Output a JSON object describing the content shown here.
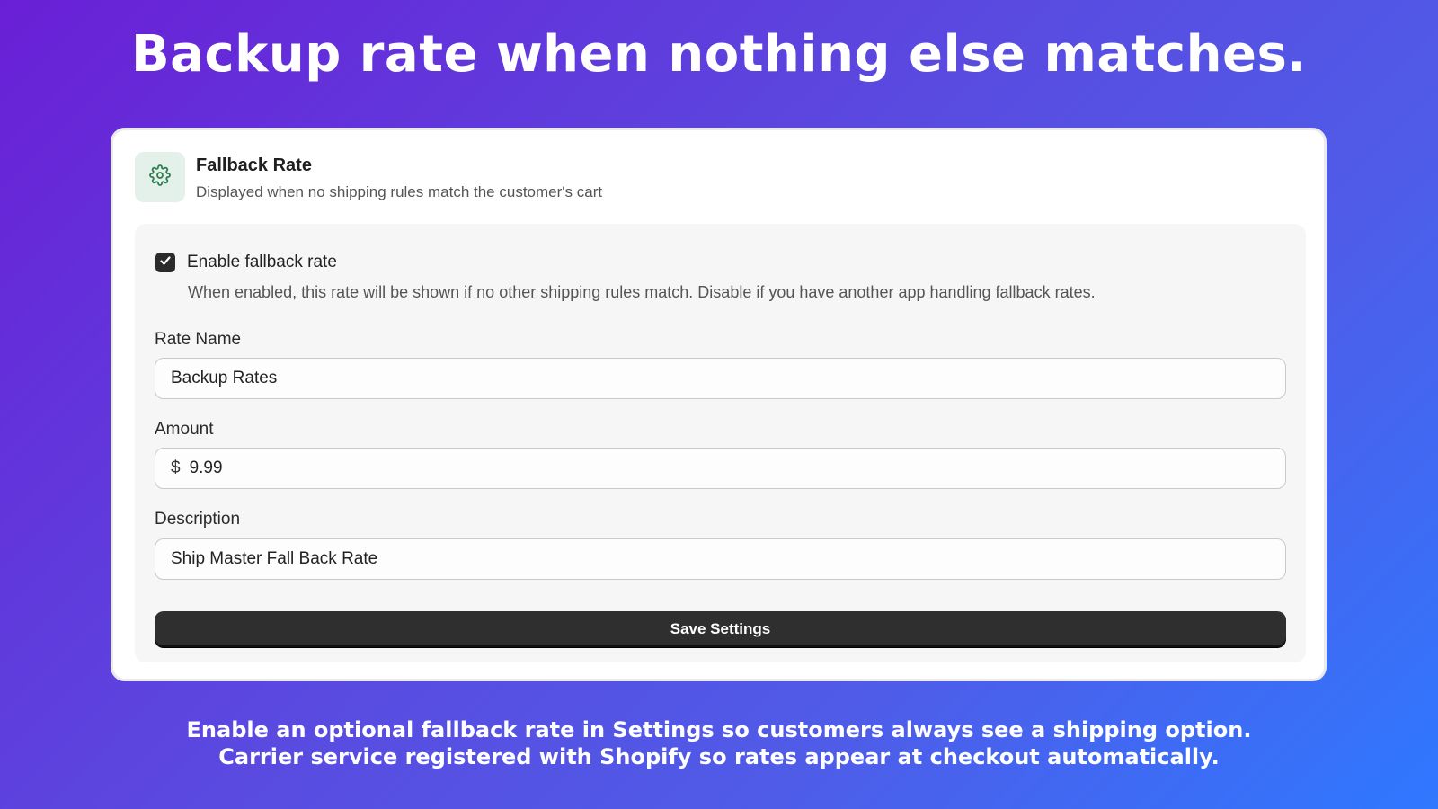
{
  "headline": "Backup rate when nothing else matches.",
  "card": {
    "icon": "gear-icon",
    "title": "Fallback Rate",
    "subtitle": "Displayed when no shipping rules match the customer's cart"
  },
  "settings": {
    "enable_checkbox": {
      "label": "Enable fallback rate",
      "checked": true
    },
    "enable_help": "When enabled, this rate will be shown if no other shipping rules match. Disable if you have another app handling fallback rates.",
    "rate_name": {
      "label": "Rate Name",
      "value": "Backup Rates"
    },
    "amount": {
      "label": "Amount",
      "prefix": "$",
      "value": "9.99"
    },
    "description": {
      "label": "Description",
      "value": "Ship Master Fall Back Rate"
    },
    "save_label": "Save Settings"
  },
  "footer": {
    "line1": "Enable an optional fallback rate in Settings so customers always see a shipping option.",
    "line2": "Carrier service registered with Shopify so rates appear at checkout automatically."
  },
  "colors": {
    "icon_tile_bg": "#e3f1ea",
    "icon_color": "#2e7d4f",
    "button_bg": "#2f2f2f"
  }
}
